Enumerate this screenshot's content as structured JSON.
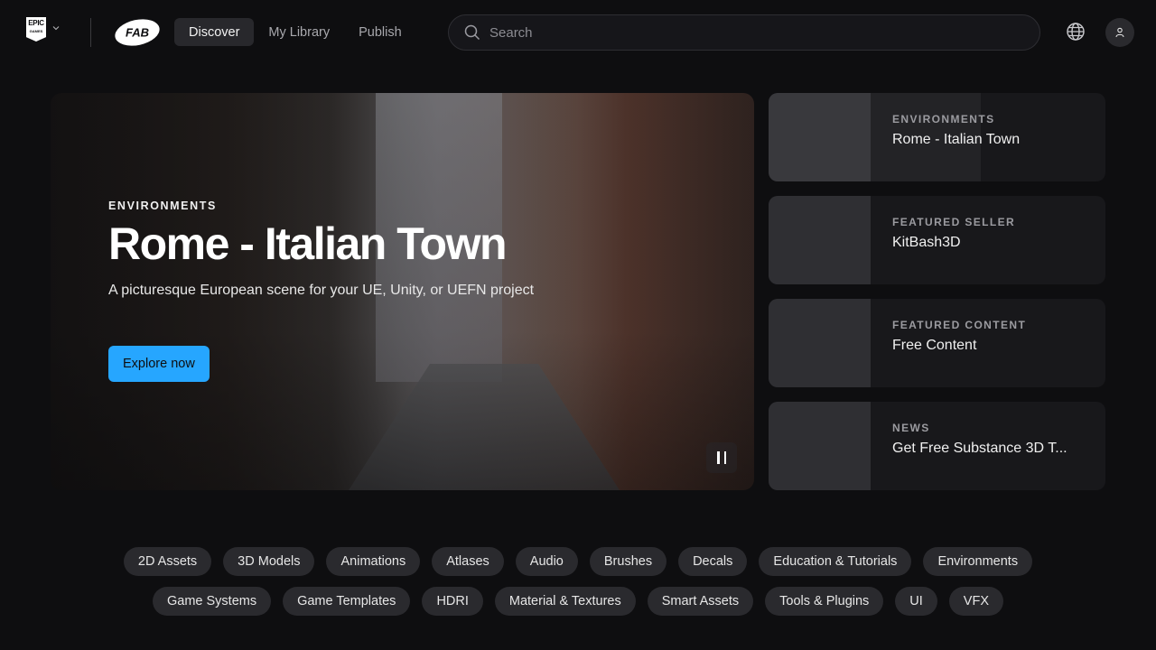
{
  "header": {
    "brand": {
      "epic_top": "EPIC",
      "epic_bottom": "GAMES",
      "product": "FAB"
    },
    "nav": [
      {
        "label": "Discover",
        "active": true
      },
      {
        "label": "My Library",
        "active": false
      },
      {
        "label": "Publish",
        "active": false
      }
    ],
    "search": {
      "placeholder": "Search",
      "value": ""
    },
    "icons": {
      "language": "globe-icon",
      "account": "user-icon"
    }
  },
  "hero": {
    "category": "ENVIRONMENTS",
    "title": "Rome - Italian Town",
    "description": "A picturesque European scene for your UE, Unity, or UEFN project",
    "cta_label": "Explore now",
    "cta_color": "#26a6ff",
    "playback": "pause"
  },
  "featured": [
    {
      "category": "ENVIRONMENTS",
      "title": "Rome - Italian Town",
      "active": true,
      "progress_percent": 63
    },
    {
      "category": "FEATURED SELLER",
      "title": "KitBash3D",
      "active": false
    },
    {
      "category": "FEATURED CONTENT",
      "title": "Free Content",
      "active": false
    },
    {
      "category": "NEWS",
      "title": "Get Free Substance 3D T...",
      "active": false
    }
  ],
  "categories": {
    "row1": [
      "2D Assets",
      "3D Models",
      "Animations",
      "Atlases",
      "Audio",
      "Brushes",
      "Decals",
      "Education & Tutorials",
      "Environments"
    ],
    "row2": [
      "Game Systems",
      "Game Templates",
      "HDRI",
      "Material & Textures",
      "Smart Assets",
      "Tools & Plugins",
      "UI",
      "VFX"
    ]
  }
}
